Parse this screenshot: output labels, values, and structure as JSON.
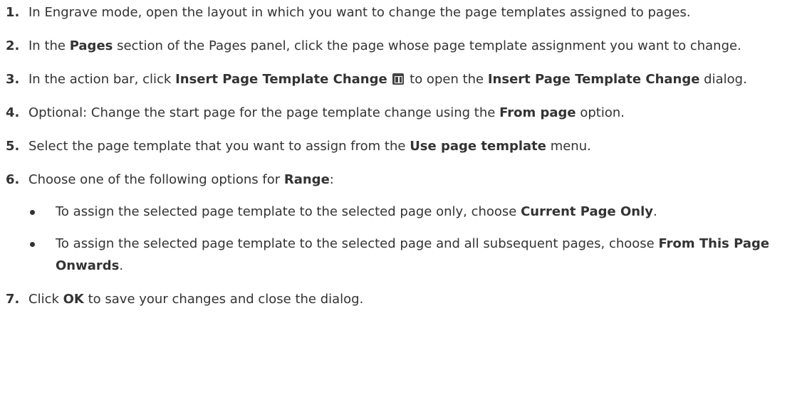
{
  "steps": [
    {
      "num": "1.",
      "text": "In Engrave mode, open the layout in which you want to change the page templates assigned to pages."
    },
    {
      "num": "2.",
      "pre": "In the ",
      "bold1": "Pages",
      "post": " section of the Pages panel, click the page whose page template assignment you want to change."
    },
    {
      "num": "3.",
      "pre": "In the action bar, click ",
      "bold1": "Insert Page Template Change",
      "icon": "page-template-change-icon",
      "mid": " to open the ",
      "bold2": "Insert Page Template Change",
      "post": " dialog."
    },
    {
      "num": "4.",
      "pre": "Optional: Change the start page for the page template change using the ",
      "bold1": "From page",
      "post": " option."
    },
    {
      "num": "5.",
      "pre": "Select the page template that you want to assign from the ",
      "bold1": "Use page template",
      "post": " menu."
    },
    {
      "num": "6.",
      "pre": "Choose one of the following options for ",
      "bold1": "Range",
      "post": ":",
      "bullets": [
        {
          "pre": "To assign the selected page template to the selected page only, choose ",
          "bold": "Current Page Only",
          "post": "."
        },
        {
          "pre": "To assign the selected page template to the selected page and all subsequent pages, choose ",
          "bold": "From This Page Onwards",
          "post": "."
        }
      ]
    },
    {
      "num": "7.",
      "pre": "Click ",
      "bold1": "OK",
      "post": " to save your changes and close the dialog."
    }
  ]
}
